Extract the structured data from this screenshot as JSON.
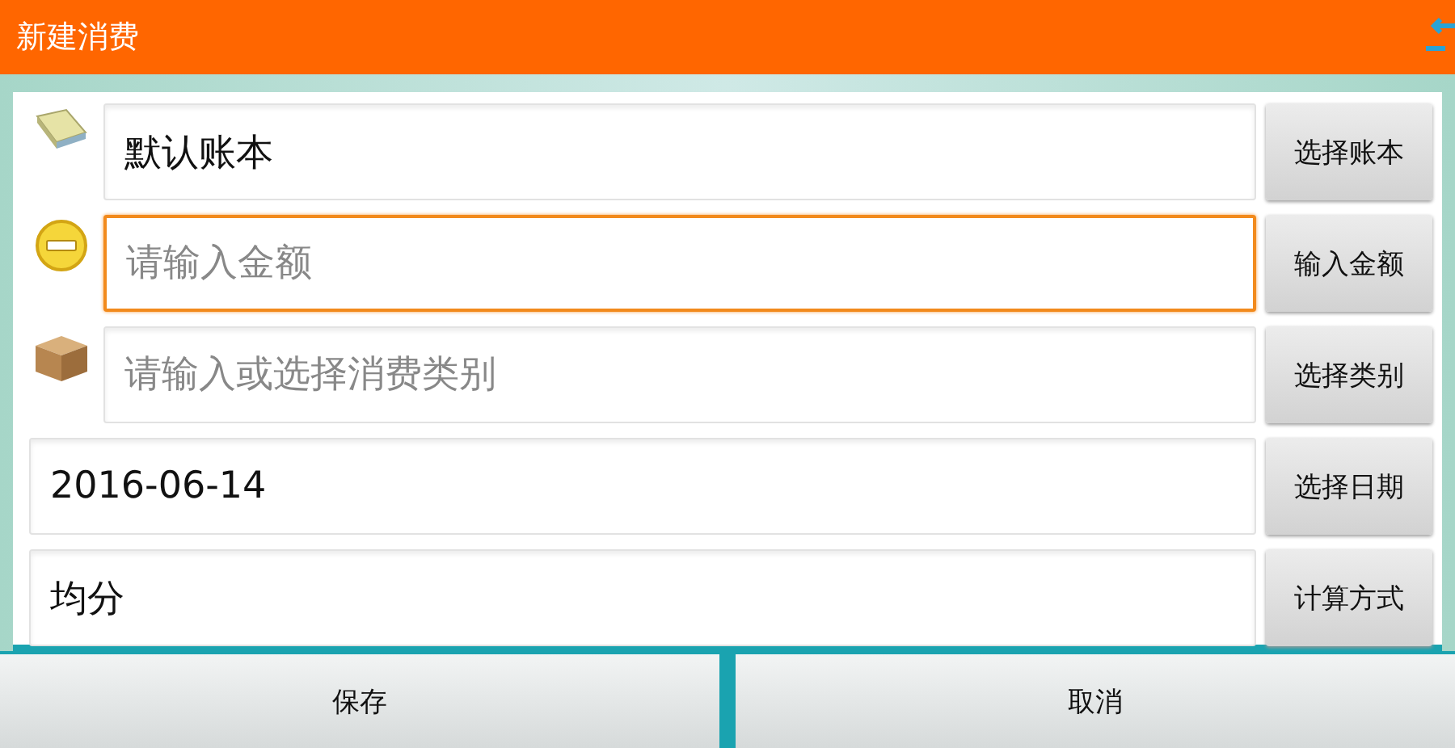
{
  "title_bar": {
    "title": "新建消费"
  },
  "rows": [
    {
      "kind": "book",
      "value": "默认账本",
      "focused": false,
      "button": "选择账本"
    },
    {
      "kind": "coin",
      "placeholder": "请输入金额",
      "focused": true,
      "button": "输入金额"
    },
    {
      "kind": "box",
      "placeholder": "请输入或选择消费类别",
      "focused": false,
      "button": "选择类别"
    },
    {
      "kind": "plain",
      "value": "2016-06-14",
      "focused": false,
      "button": "选择日期"
    },
    {
      "kind": "plain",
      "value": "均分",
      "focused": false,
      "button": "计算方式"
    }
  ],
  "bottom_buttons": [
    "保存",
    "取消"
  ]
}
